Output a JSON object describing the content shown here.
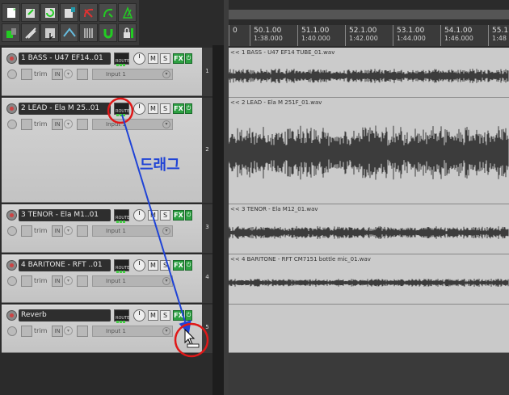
{
  "toolbar": {
    "buttons": [
      "new-project-icon",
      "open-project-icon",
      "save-project-icon",
      "project-settings-icon",
      "undo-icon",
      "redo-icon",
      "metronome-icon",
      "render-icon",
      "ripple-edit-icon",
      "grid-icon",
      "auto-crossfade-icon",
      "envelope-icon",
      "snap-icon",
      "lock-icon"
    ]
  },
  "tracks": [
    {
      "number": "1",
      "name": "1 BASS - U47 EF14..01",
      "route_label": "ROUTE",
      "trim": "trim",
      "in": "IN",
      "input": "Input 1",
      "item_label": "<< 1 BASS - U47 EF14 TUBE_01.wav"
    },
    {
      "number": "2",
      "name": "2 LEAD - Ela M 25..01",
      "route_label": "ROUTE",
      "trim": "trim",
      "in": "IN",
      "input": "Input 1",
      "item_label": "<< 2 LEAD - Ela M 251F_01.wav"
    },
    {
      "number": "3",
      "name": "3 TENOR - Ela M1..01",
      "route_label": "ROUTE",
      "trim": "trim",
      "in": "IN",
      "input": "Input 1",
      "item_label": "<< 3 TENOR - Ela M12_01.wav"
    },
    {
      "number": "4",
      "name": "4 BARITONE - RFT ..01",
      "route_label": "ROUTE",
      "trim": "trim",
      "in": "IN",
      "input": "Input 1",
      "item_label": "<< 4 BARITONE - RFT CM7151 bottle mic_01.wav"
    },
    {
      "number": "5",
      "name": "Reverb",
      "route_label": "ROUTE",
      "trim": "trim",
      "in": "IN",
      "input": "Input 1",
      "item_label": ""
    }
  ],
  "buttons": {
    "mute": "M",
    "solo": "S",
    "fx": "FX",
    "power": "⏻"
  },
  "ruler": {
    "ticks": [
      {
        "bar": "0",
        "time": ""
      },
      {
        "bar": "50.1.00",
        "time": "1:38.000"
      },
      {
        "bar": "51.1.00",
        "time": "1:40.000"
      },
      {
        "bar": "52.1.00",
        "time": "1:42.000"
      },
      {
        "bar": "53.1.00",
        "time": "1:44.000"
      },
      {
        "bar": "54.1.00",
        "time": "1:46.000"
      },
      {
        "bar": "55.1.00",
        "time": "1:48"
      }
    ]
  },
  "annotation": {
    "drag_text": "드래그"
  },
  "colors": {
    "annotation_blue": "#1f43d6",
    "circle_red": "#e01818",
    "fx_green": "#2ea043",
    "waveform": "#3c3c3c"
  }
}
